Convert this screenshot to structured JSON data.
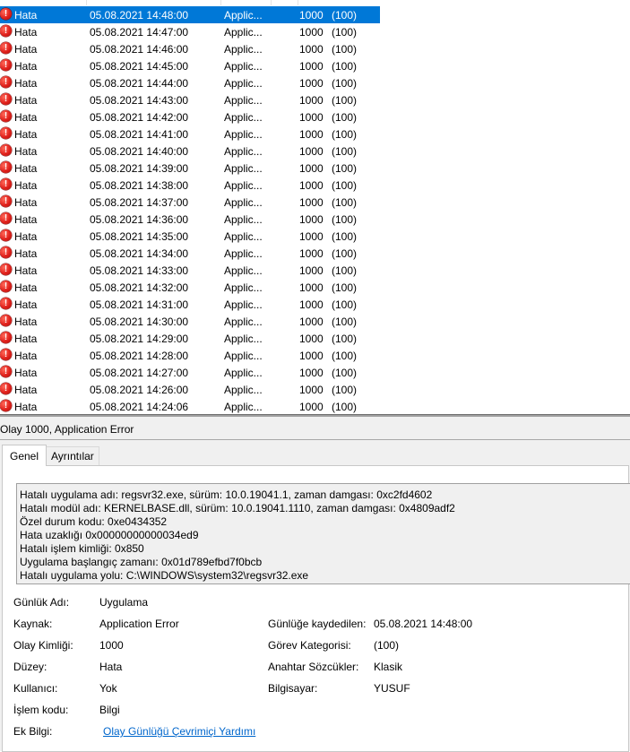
{
  "events": [
    {
      "level": "Hata",
      "date": "05.08.2021 14:48:00",
      "source": "Applic...",
      "id": "1000",
      "category": "(100)",
      "selected": true
    },
    {
      "level": "Hata",
      "date": "05.08.2021 14:47:00",
      "source": "Applic...",
      "id": "1000",
      "category": "(100)"
    },
    {
      "level": "Hata",
      "date": "05.08.2021 14:46:00",
      "source": "Applic...",
      "id": "1000",
      "category": "(100)"
    },
    {
      "level": "Hata",
      "date": "05.08.2021 14:45:00",
      "source": "Applic...",
      "id": "1000",
      "category": "(100)"
    },
    {
      "level": "Hata",
      "date": "05.08.2021 14:44:00",
      "source": "Applic...",
      "id": "1000",
      "category": "(100)"
    },
    {
      "level": "Hata",
      "date": "05.08.2021 14:43:00",
      "source": "Applic...",
      "id": "1000",
      "category": "(100)"
    },
    {
      "level": "Hata",
      "date": "05.08.2021 14:42:00",
      "source": "Applic...",
      "id": "1000",
      "category": "(100)"
    },
    {
      "level": "Hata",
      "date": "05.08.2021 14:41:00",
      "source": "Applic...",
      "id": "1000",
      "category": "(100)"
    },
    {
      "level": "Hata",
      "date": "05.08.2021 14:40:00",
      "source": "Applic...",
      "id": "1000",
      "category": "(100)"
    },
    {
      "level": "Hata",
      "date": "05.08.2021 14:39:00",
      "source": "Applic...",
      "id": "1000",
      "category": "(100)"
    },
    {
      "level": "Hata",
      "date": "05.08.2021 14:38:00",
      "source": "Applic...",
      "id": "1000",
      "category": "(100)"
    },
    {
      "level": "Hata",
      "date": "05.08.2021 14:37:00",
      "source": "Applic...",
      "id": "1000",
      "category": "(100)"
    },
    {
      "level": "Hata",
      "date": "05.08.2021 14:36:00",
      "source": "Applic...",
      "id": "1000",
      "category": "(100)"
    },
    {
      "level": "Hata",
      "date": "05.08.2021 14:35:00",
      "source": "Applic...",
      "id": "1000",
      "category": "(100)"
    },
    {
      "level": "Hata",
      "date": "05.08.2021 14:34:00",
      "source": "Applic...",
      "id": "1000",
      "category": "(100)"
    },
    {
      "level": "Hata",
      "date": "05.08.2021 14:33:00",
      "source": "Applic...",
      "id": "1000",
      "category": "(100)"
    },
    {
      "level": "Hata",
      "date": "05.08.2021 14:32:00",
      "source": "Applic...",
      "id": "1000",
      "category": "(100)"
    },
    {
      "level": "Hata",
      "date": "05.08.2021 14:31:00",
      "source": "Applic...",
      "id": "1000",
      "category": "(100)"
    },
    {
      "level": "Hata",
      "date": "05.08.2021 14:30:00",
      "source": "Applic...",
      "id": "1000",
      "category": "(100)"
    },
    {
      "level": "Hata",
      "date": "05.08.2021 14:29:00",
      "source": "Applic...",
      "id": "1000",
      "category": "(100)"
    },
    {
      "level": "Hata",
      "date": "05.08.2021 14:28:00",
      "source": "Applic...",
      "id": "1000",
      "category": "(100)"
    },
    {
      "level": "Hata",
      "date": "05.08.2021 14:27:00",
      "source": "Applic...",
      "id": "1000",
      "category": "(100)"
    },
    {
      "level": "Hata",
      "date": "05.08.2021 14:26:00",
      "source": "Applic...",
      "id": "1000",
      "category": "(100)"
    },
    {
      "level": "Hata",
      "date": "05.08.2021 14:24:06",
      "source": "Applic...",
      "id": "1000",
      "category": "(100)"
    }
  ],
  "event_icon": "error-icon",
  "details": {
    "title": "Olay 1000, Application Error",
    "tabs": [
      "Genel",
      "Ayrıntılar"
    ],
    "description_lines": [
      "Hatalı uygulama adı: regsvr32.exe, sürüm: 10.0.19041.1, zaman damgası: 0xc2fd4602",
      "Hatalı modül adı: KERNELBASE.dll, sürüm: 10.0.19041.1110, zaman damgası: 0x4809adf2",
      "Özel durum kodu: 0xe0434352",
      "Hata uzaklığı 0x00000000000034ed9",
      "Hatalı işlem kimliği: 0x850",
      "Uygulama başlangıç zamanı: 0x01d789efbd7f0bcb",
      "Hatalı uygulama yolu: C:\\WINDOWS\\system32\\regsvr32.exe"
    ],
    "props": {
      "log_name_label": "Günlük Adı:",
      "log_name": "Uygulama",
      "source_label": "Kaynak:",
      "source": "Application Error",
      "event_id_label": "Olay Kimliği:",
      "event_id": "1000",
      "level_label": "Düzey:",
      "level": "Hata",
      "user_label": "Kullanıcı:",
      "user": "Yok",
      "opcode_label": "İşlem kodu:",
      "opcode": "Bilgi",
      "more_info_label": "Ek Bilgi:",
      "more_info_link": "Olay Günlüğü Çevrimiçi Yardımı",
      "logged_label": "Günlüğe kaydedilen:",
      "logged": "05.08.2021 14:48:00",
      "task_category_label": "Görev Kategorisi:",
      "task_category": "(100)",
      "keywords_label": "Anahtar Sözcükler:",
      "keywords": "Klasik",
      "computer_label": "Bilgisayar:",
      "computer": "YUSUF"
    }
  }
}
